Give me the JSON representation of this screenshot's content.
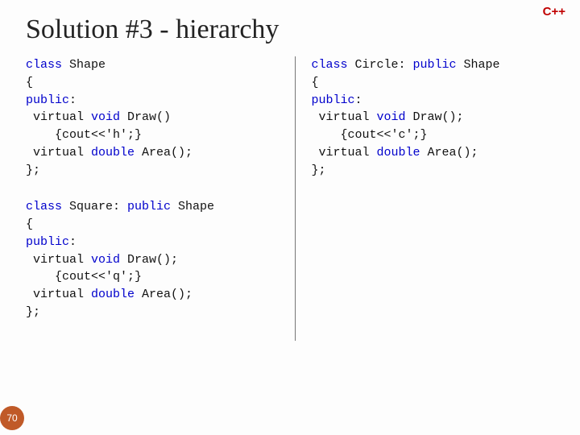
{
  "badge": "C++",
  "title": "Solution #3 - hierarchy",
  "page_number": "70",
  "code": {
    "shape": {
      "l1a": "class",
      "l1b": " Shape",
      "l2": "{",
      "l3a": "public",
      "l3b": ":",
      "l4a": " virtual ",
      "l4b": "void",
      "l4c": " Draw()",
      "l5": "    {cout<<'h';}",
      "l6a": " virtual ",
      "l6b": "double",
      "l6c": " Area();",
      "l7": "};"
    },
    "square": {
      "l1a": "class",
      "l1b": " Square: ",
      "l1c": "public",
      "l1d": " Shape",
      "l2": "{",
      "l3a": "public",
      "l3b": ":",
      "l4a": " virtual ",
      "l4b": "void",
      "l4c": " Draw();",
      "l5": "    {cout<<'q';}",
      "l6a": " virtual ",
      "l6b": "double",
      "l6c": " Area();",
      "l7": "};"
    },
    "circle": {
      "l1a": "class",
      "l1b": " Circle: ",
      "l1c": "public",
      "l1d": " Shape",
      "l2": "{",
      "l3a": "public",
      "l3b": ":",
      "l4a": " virtual ",
      "l4b": "void",
      "l4c": " Draw();",
      "l5": "    {cout<<'c';}",
      "l6a": " virtual ",
      "l6b": "double",
      "l6c": " Area();",
      "l7": "};"
    }
  }
}
